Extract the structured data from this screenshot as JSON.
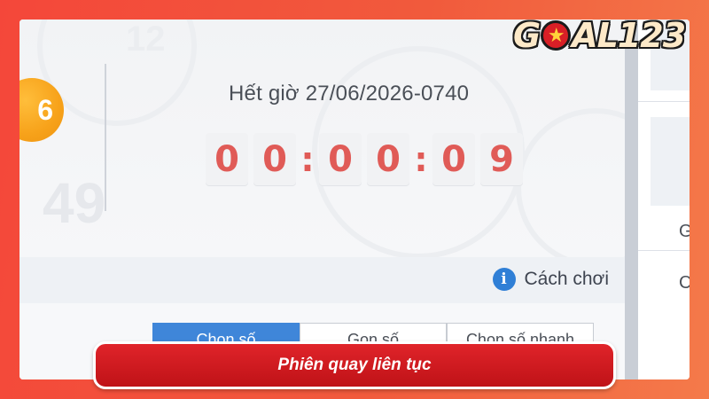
{
  "brand": {
    "logo_left": "G",
    "logo_mid": "★",
    "logo_right": "AL123"
  },
  "draw": {
    "ball_number": "6",
    "deadline_label": "Hết giờ 27/06/2026-0740",
    "countdown": {
      "hours": [
        "0",
        "0"
      ],
      "minutes": [
        "0",
        "0"
      ],
      "seconds": [
        "0",
        "9"
      ],
      "separator": ":"
    },
    "background_numbers": [
      "49",
      "12"
    ]
  },
  "help": {
    "label": "Cách chơi",
    "icon": "info-icon"
  },
  "tabs": [
    {
      "label": "Chọn số",
      "active": true
    },
    {
      "label": "Gọn số",
      "active": false
    },
    {
      "label": "Chọn số nhanh",
      "active": false
    }
  ],
  "right_column": {
    "chars": [
      "G",
      "C"
    ]
  },
  "caption": {
    "text": "Phiên quay liên tục"
  },
  "colors": {
    "accent_blue": "#3f86d9",
    "countdown_red": "#e05b57",
    "ball_orange": "#f7a21a",
    "banner_red": "#d81f26"
  }
}
